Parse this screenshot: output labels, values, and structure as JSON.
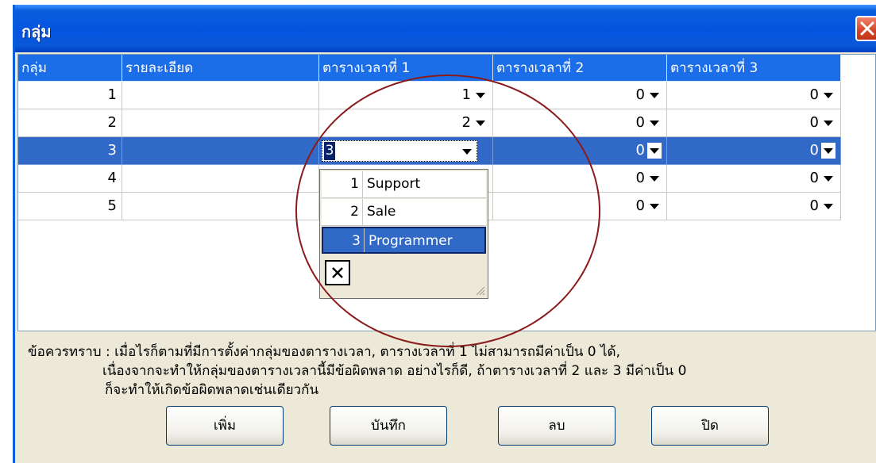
{
  "window": {
    "title": "กลุ่ม"
  },
  "grid": {
    "columns": [
      "กลุ่ม",
      "รายละเอียด",
      "ตารางเวลาที่ 1",
      "ตารางเวลาที่ 2",
      "ตารางเวลาที่ 3"
    ],
    "rows": [
      {
        "group": "1",
        "detail": "",
        "t1": "1",
        "t2": "0",
        "t3": "0"
      },
      {
        "group": "2",
        "detail": "",
        "t1": "2",
        "t2": "0",
        "t3": "0"
      },
      {
        "group": "3",
        "detail": "",
        "t1": "3",
        "t2": "0",
        "t3": "0",
        "selected": true,
        "editing": true
      },
      {
        "group": "4",
        "detail": "",
        "t1": "",
        "t2": "0",
        "t3": "0"
      },
      {
        "group": "5",
        "detail": "",
        "t1": "",
        "t2": "0",
        "t3": "0"
      }
    ]
  },
  "dropdown": {
    "options": [
      {
        "num": "1",
        "name": "Support"
      },
      {
        "num": "2",
        "name": "Sale"
      },
      {
        "num": "3",
        "name": "Programmer",
        "selected": true
      }
    ]
  },
  "note": {
    "line1": "ข้อควรทราบ : เมื่อไรก็ตามที่มีการตั้งค่ากลุ่มของตารางเวลา, ตารางเวลาที่ 1 ไม่สามารถมีค่าเป็น 0 ได้,",
    "line2": "เนื่องจากจะทำให้กลุ่มของตารางเวลานี้มีข้อผิดพลาด อย่างไรก็ดี, ถ้าตารางเวลาที่ 2 และ 3 มีค่าเป็น 0",
    "line3": "ก็จะทำให้เกิดข้อผิดพลาดเช่นเดียวกัน"
  },
  "buttons": {
    "add": "เพิ่ม",
    "save": "บันทึก",
    "delete": "ลบ",
    "close": "ปิด"
  },
  "icons": {
    "close": "close-icon",
    "dropdown": "chevron-down-icon",
    "clear": "x-icon",
    "grip": "resize-grip-icon"
  },
  "colors": {
    "titlebar": "#0454e0",
    "header": "#1c6ee8",
    "selection": "#3169c6",
    "annotation": "#8b1a1a"
  }
}
